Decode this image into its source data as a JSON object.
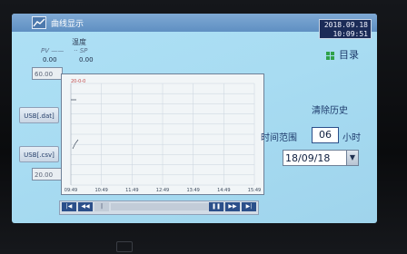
{
  "window": {
    "title": "曲线显示"
  },
  "datetime": {
    "date": "2018.09.18",
    "time": "10:09:51"
  },
  "menu": {
    "label": "目录"
  },
  "trend": {
    "legend_title": "温度",
    "pv_label": "PV",
    "sp_label": "SP",
    "pv_value": "0.00",
    "sp_value": "0.00",
    "y_max": "60.00",
    "y_min": "20.00",
    "chart_header": "20-0-0"
  },
  "buttons": {
    "usb_dat": "USB[.dat]",
    "usb_csv": "USB[.csv]",
    "clear_history": "清除历史"
  },
  "time_range": {
    "label": "时间范围",
    "value": "06",
    "unit": "小时"
  },
  "date_select": {
    "value": "18/09/18"
  },
  "chart_data": {
    "type": "line",
    "categories": [
      "09:49",
      "10:49",
      "11:49",
      "12:49",
      "13:49",
      "14:49",
      "15:49"
    ],
    "series": [
      {
        "values": []
      }
    ]
  },
  "colors": {
    "screen_bg": "#a8dcf2",
    "title_bar": "#6d9ccb",
    "accent_blue": "#2b4f8a"
  }
}
